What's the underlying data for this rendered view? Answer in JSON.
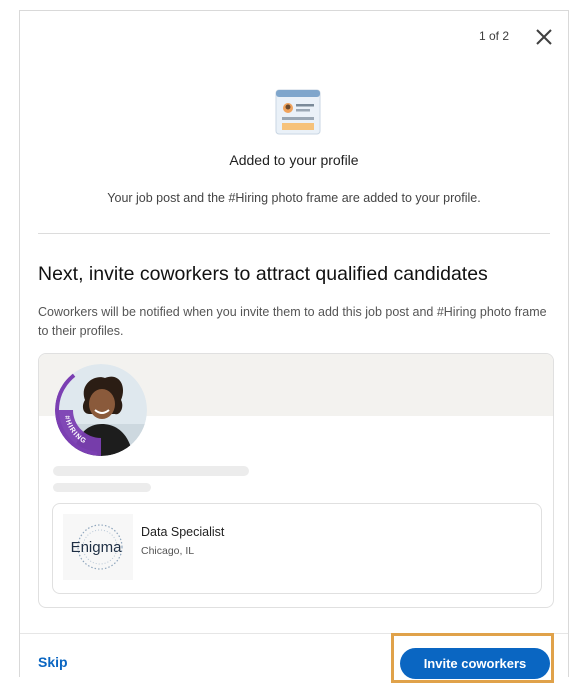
{
  "header": {
    "step": "1 of 2",
    "close_icon": "close-icon"
  },
  "confirmation": {
    "icon": "profile-card-icon",
    "title": "Added to your profile",
    "description": "Your job post and the #Hiring photo frame are added to your profile."
  },
  "invite": {
    "title": "Next, invite coworkers to attract qualified candidates",
    "description": "Coworkers will be notified when you invite them to add this job post and #Hiring photo frame to their profiles."
  },
  "preview": {
    "frame_text": "#HIRING",
    "job": {
      "company_logo_text": "Enigma",
      "title": "Data Specialist",
      "location": "Chicago, IL"
    }
  },
  "footer": {
    "skip_label": "Skip",
    "invite_label": "Invite coworkers"
  },
  "colors": {
    "accent": "#0a66c2",
    "frame": "#7b3fb2",
    "highlight": "#e0a24a"
  }
}
